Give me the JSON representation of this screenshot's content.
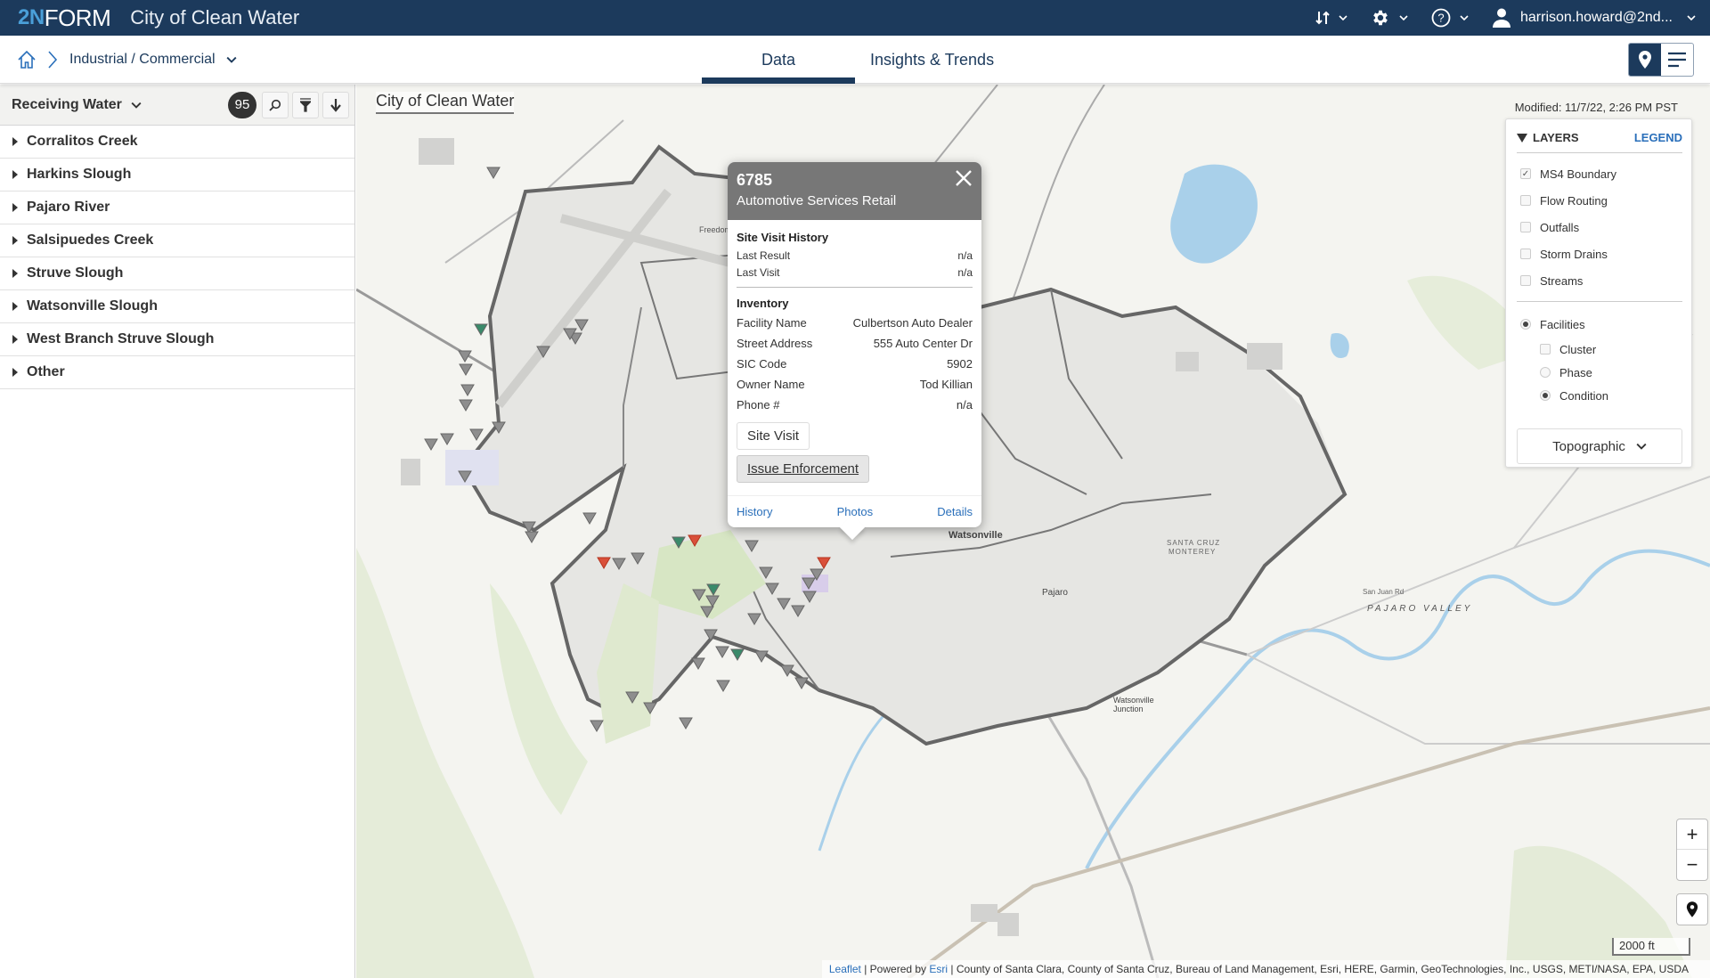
{
  "header": {
    "logo_mark": "2N",
    "logo_word": "FORM",
    "app_title": "City of Clean Water",
    "user": "harrison.howard@2nd..."
  },
  "subbar": {
    "breadcrumb": "Industrial / Commercial",
    "tabs": [
      {
        "label": "Data",
        "active": true
      },
      {
        "label": "Insights & Trends",
        "active": false
      }
    ]
  },
  "sidebar": {
    "title": "Receiving Water",
    "count": "95",
    "items": [
      {
        "label": "Corralitos Creek"
      },
      {
        "label": "Harkins Slough"
      },
      {
        "label": "Pajaro River"
      },
      {
        "label": "Salsipuedes Creek"
      },
      {
        "label": "Struve Slough"
      },
      {
        "label": "Watsonville Slough"
      },
      {
        "label": "West Branch Struve Slough"
      },
      {
        "label": "Other"
      }
    ]
  },
  "map": {
    "title": "City of Clean Water",
    "modified": "Modified: 11/7/22, 2:26 PM PST",
    "scale": "2000 ft",
    "zoom_in": "+",
    "zoom_out": "−",
    "attribution": {
      "leaflet": "Leaflet",
      "powered": " | Powered by ",
      "esri": "Esri",
      "rest": " | County of Santa Clara, County of Santa Cruz, Bureau of Land Management, Esri, HERE, Garmin, GeoTechnologies, Inc., USGS, METI/NASA, EPA, USDA"
    },
    "labels": {
      "watsonville": "Watsonville",
      "pajaro": "Pajaro",
      "pajaro_valley": "PAJARO VALLEY",
      "santa_cruz": "SANTA CRUZ",
      "monterey": "MONTEREY",
      "junction": "Watsonville Junction",
      "freedom": "Freedom",
      "san_juan_rd": "San Juan Rd"
    },
    "colors": {
      "good": "#3a8a6a",
      "bad": "#d9503a",
      "neutral": "#8e8e8e",
      "boundary": "#666666",
      "water": "#a9d0ea",
      "park": "#d7e6c4"
    }
  },
  "layers": {
    "title": "LAYERS",
    "legend": "LEGEND",
    "items": [
      {
        "label": "MS4 Boundary",
        "checked": true
      },
      {
        "label": "Flow Routing",
        "checked": false
      },
      {
        "label": "Outfalls",
        "checked": false
      },
      {
        "label": "Storm Drains",
        "checked": false
      },
      {
        "label": "Streams",
        "checked": false
      }
    ],
    "facilities": {
      "label": "Facilities",
      "selected": true,
      "cluster": {
        "label": "Cluster",
        "checked": false
      },
      "phase": {
        "label": "Phase",
        "selected": false
      },
      "condition": {
        "label": "Condition",
        "selected": true
      }
    },
    "basemap": "Topographic"
  },
  "popup": {
    "id": "6785",
    "type": "Automotive Services Retail",
    "history_title": "Site Visit History",
    "last_result_label": "Last Result",
    "last_result": "n/a",
    "last_visit_label": "Last Visit",
    "last_visit": "n/a",
    "inventory_title": "Inventory",
    "facility_name_label": "Facility Name",
    "facility_name": "Culbertson Auto Dealer",
    "street_label": "Street Address",
    "street": "555 Auto Center Dr",
    "sic_label": "SIC Code",
    "sic": "5902",
    "owner_label": "Owner Name",
    "owner": "Tod Killian",
    "phone_label": "Phone #",
    "phone": "n/a",
    "site_visit_btn": "Site Visit",
    "enforcement_btn": "Issue Enforcement",
    "links": [
      "History",
      "Photos",
      "Details"
    ]
  }
}
